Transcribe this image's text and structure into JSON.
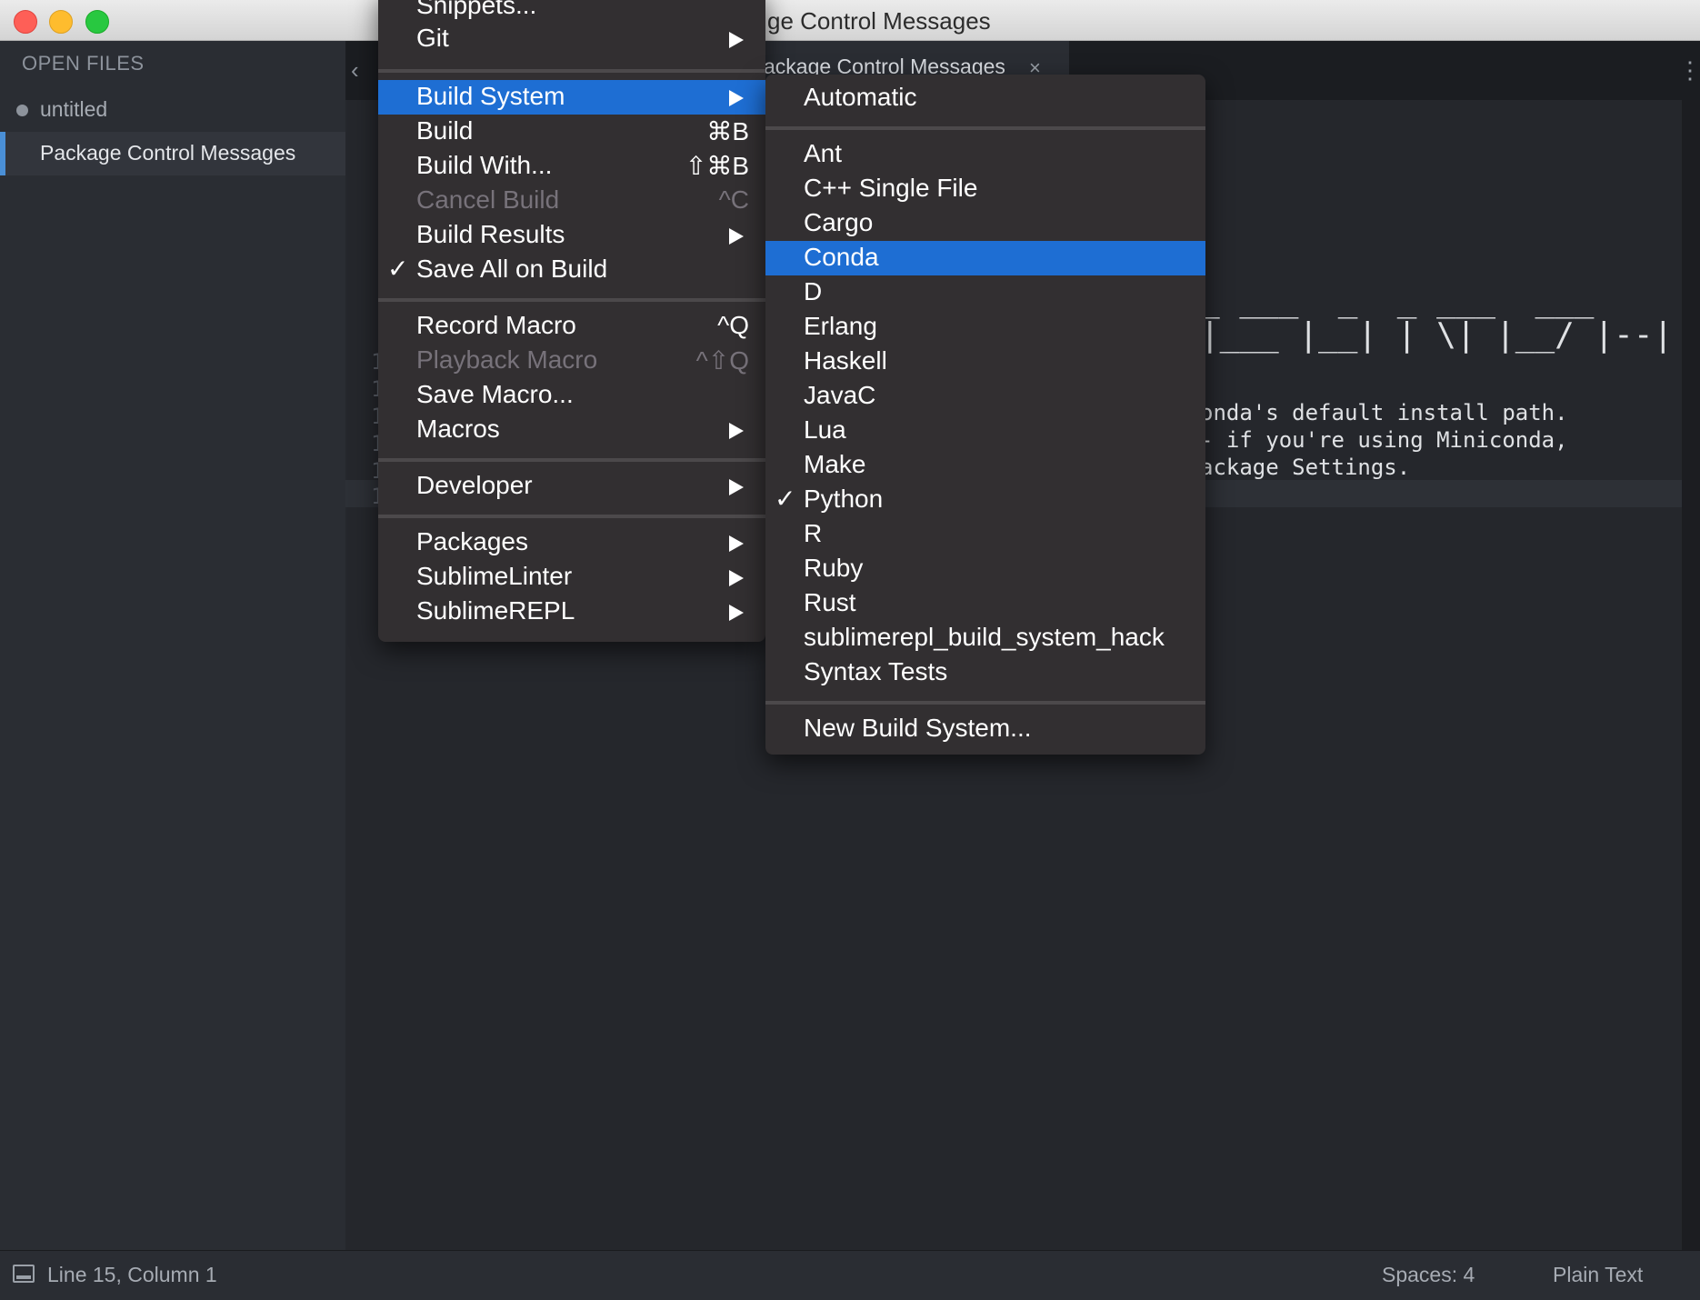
{
  "window": {
    "title": "Package Control Messages",
    "title_visible": "ge Control Messages"
  },
  "sidebar": {
    "header": "OPEN FILES",
    "files": [
      {
        "label": "untitled"
      },
      {
        "label": "Package Control Messages"
      }
    ]
  },
  "tabs": [
    {
      "label": "Package Control Messages",
      "label_visible": "ackage Control Messages",
      "close": "×"
    }
  ],
  "tab_nav": {
    "left": "‹",
    "more": "⋮"
  },
  "editor": {
    "ascii_lines": [
      "_ ___  _  _ ___  ___",
      "|___ |__| | \\| |__/ |--|"
    ],
    "gutter": [
      "1",
      "1",
      "1",
      "1",
      "1",
      "1"
    ],
    "lines": [
      "onda's default install path.",
      "- if you're using Miniconda,",
      "ackage Settings."
    ]
  },
  "tools_menu": {
    "items": [
      {
        "label": "Snippets...",
        "shortcut": "",
        "submenu": false,
        "disabled": false
      },
      {
        "label": "Git",
        "shortcut": "",
        "submenu": true,
        "disabled": false
      },
      {
        "label": "Build System",
        "shortcut": "",
        "submenu": true,
        "highlighted": true
      },
      {
        "label": "Build",
        "shortcut": "⌘B"
      },
      {
        "label": "Build With...",
        "shortcut": "⇧⌘B"
      },
      {
        "label": "Cancel Build",
        "shortcut": "^C",
        "disabled": true
      },
      {
        "label": "Build Results",
        "submenu": true
      },
      {
        "label": "Save All on Build",
        "checked": true
      },
      {
        "label": "Record Macro",
        "shortcut": "^Q"
      },
      {
        "label": "Playback Macro",
        "shortcut": "^⇧Q",
        "disabled": true
      },
      {
        "label": "Save Macro..."
      },
      {
        "label": "Macros",
        "submenu": true
      },
      {
        "label": "Developer",
        "submenu": true
      },
      {
        "label": "Packages",
        "submenu": true
      },
      {
        "label": "SublimeLinter",
        "submenu": true
      },
      {
        "label": "SublimeREPL",
        "submenu": true
      }
    ]
  },
  "build_system_menu": {
    "items": [
      {
        "label": "Automatic"
      },
      {
        "label": "Ant"
      },
      {
        "label": "C++ Single File"
      },
      {
        "label": "Cargo"
      },
      {
        "label": "Conda",
        "highlighted": true
      },
      {
        "label": "D"
      },
      {
        "label": "Erlang"
      },
      {
        "label": "Haskell"
      },
      {
        "label": "JavaC"
      },
      {
        "label": "Lua"
      },
      {
        "label": "Make"
      },
      {
        "label": "Python",
        "checked": true
      },
      {
        "label": "R"
      },
      {
        "label": "Ruby"
      },
      {
        "label": "Rust"
      },
      {
        "label": "sublimerepl_build_system_hack"
      },
      {
        "label": "Syntax Tests"
      },
      {
        "label": "New Build System..."
      }
    ],
    "check_glyph": "✓"
  },
  "statusbar": {
    "position": "Line 15, Column 1",
    "spaces": "Spaces: 4",
    "syntax": "Plain Text"
  },
  "colors": {
    "highlight": "#1e6ed3",
    "menu_bg": "#322f31",
    "sidebar_bg": "#2a2d33",
    "editor_bg": "#25272c",
    "accent": "#4a8fd6"
  }
}
